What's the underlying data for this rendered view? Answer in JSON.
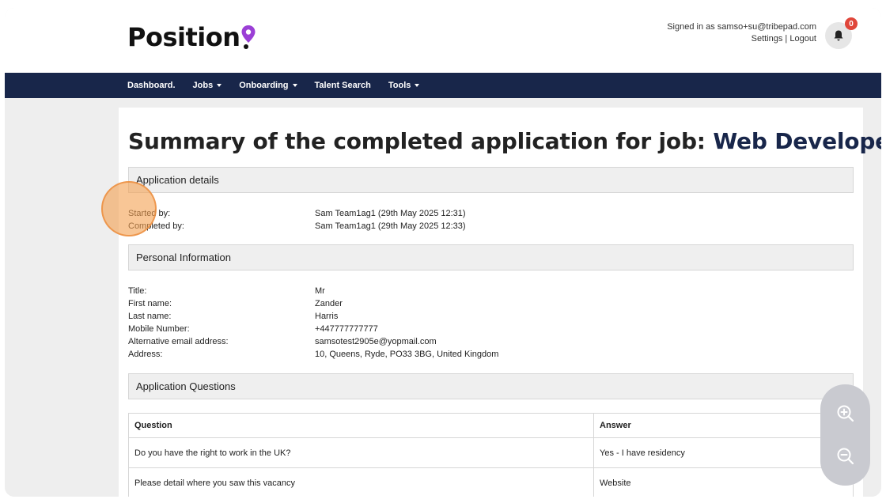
{
  "header": {
    "logo_text": "Position",
    "signed_in_text": "Signed in as samso+su@tribepad.com",
    "settings_label": "Settings",
    "separator": " | ",
    "logout_label": "Logout",
    "notification_count": "0"
  },
  "nav": {
    "items": [
      {
        "label": "Dashboard.",
        "dropdown": false
      },
      {
        "label": "Jobs",
        "dropdown": true
      },
      {
        "label": "Onboarding",
        "dropdown": true
      },
      {
        "label": "Talent Search",
        "dropdown": false
      },
      {
        "label": "Tools",
        "dropdown": true
      }
    ]
  },
  "page": {
    "title_prefix": "Summary of the completed application for job: ",
    "job_title": "Web Developer"
  },
  "application_details": {
    "heading": "Application details",
    "fields": [
      {
        "label": "Started by:",
        "value": "Sam Team1ag1 (29th May 2025 12:31)"
      },
      {
        "label": "Completed by:",
        "value": "Sam Team1ag1 (29th May 2025 12:33)"
      }
    ]
  },
  "personal_information": {
    "heading": "Personal Information",
    "fields": [
      {
        "label": "Title:",
        "value": "Mr"
      },
      {
        "label": "First name:",
        "value": "Zander"
      },
      {
        "label": "Last name:",
        "value": "Harris"
      },
      {
        "label": "Mobile Number:",
        "value": "+447777777777"
      },
      {
        "label": "Alternative email address:",
        "value": "samsotest2905e@yopmail.com"
      },
      {
        "label": "Address:",
        "value": "10, Queens, Ryde, PO33 3BG, United Kingdom"
      }
    ]
  },
  "application_questions": {
    "heading": "Application Questions",
    "columns": [
      "Question",
      "Answer"
    ],
    "rows": [
      {
        "question": "Do you have the right to work in the UK?",
        "answer": "Yes - I have residency"
      },
      {
        "question": "Please detail where you saw this vacancy",
        "answer": "Website"
      }
    ]
  },
  "icons": {
    "bell": "bell-icon",
    "zoom_in": "zoom-in-icon",
    "zoom_out": "zoom-out-icon"
  },
  "colors": {
    "nav_background": "#18264a",
    "job_title": "#18264a",
    "badge": "#e0463a",
    "logo_accent": "#9b3fd6"
  }
}
